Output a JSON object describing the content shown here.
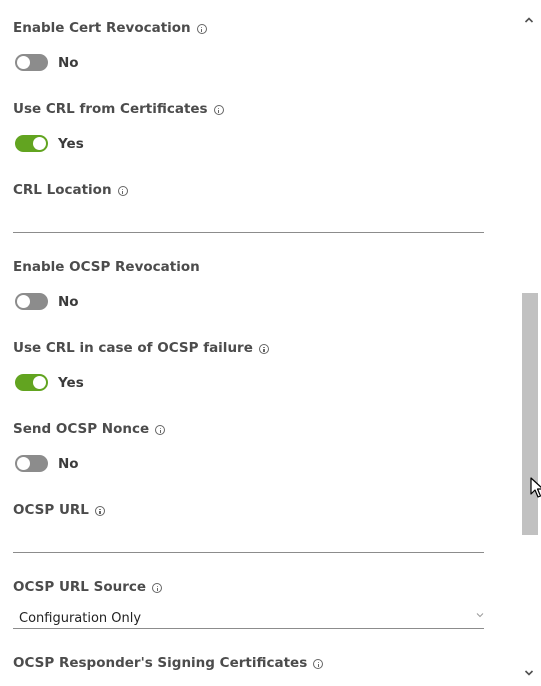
{
  "fields": [
    {
      "label": "Enable Cert Revocation",
      "info": true,
      "state": "No",
      "on": false
    },
    {
      "label": "Use CRL from Certificates",
      "info": true,
      "state": "Yes",
      "on": true
    },
    {
      "label": "CRL Location",
      "info": true,
      "value": ""
    },
    {
      "label": "Enable OCSP Revocation",
      "info": false,
      "state": "No",
      "on": false
    },
    {
      "label": "Use CRL in case of OCSP failure",
      "info": true,
      "state": "Yes",
      "on": true
    },
    {
      "label": "Send OCSP Nonce",
      "info": true,
      "state": "No",
      "on": false
    },
    {
      "label": "OCSP URL",
      "info": true,
      "value": ""
    },
    {
      "label": "OCSP URL Source",
      "info": true,
      "selected": "Configuration Only"
    },
    {
      "label": "OCSP Responder's Signing Certificates",
      "info": true
    }
  ],
  "colors": {
    "toggle_on": "#62a420",
    "toggle_off": "#8c8c8c",
    "scroll_thumb": "#c1c1c1"
  },
  "scroll_position": 0.45
}
